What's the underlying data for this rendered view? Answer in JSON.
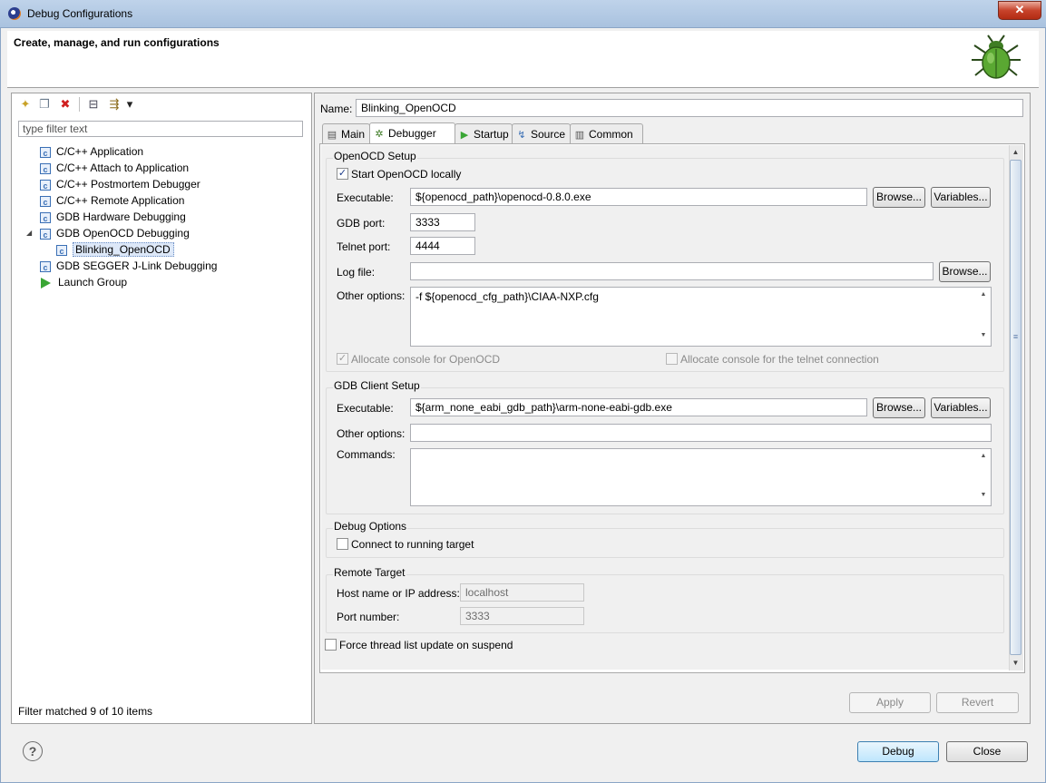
{
  "window": {
    "title": "Debug Configurations",
    "close_glyph": "✕",
    "banner_title": "Create, manage, and run configurations",
    "icon": "eclipse-icon"
  },
  "left": {
    "toolbar": [
      {
        "name": "new-configuration-icon",
        "glyph": "✦"
      },
      {
        "name": "duplicate-icon",
        "glyph": "❐"
      },
      {
        "name": "delete-icon",
        "glyph": "✖"
      },
      {
        "name": "collapse-all-icon",
        "glyph": "⊟"
      },
      {
        "name": "filter-icon",
        "glyph": "⇶"
      },
      {
        "name": "menu-dropdown-icon",
        "glyph": "▾"
      }
    ],
    "filter_placeholder": "type filter text",
    "tree": [
      {
        "label": "C/C++ Application",
        "icon": "c-icon"
      },
      {
        "label": "C/C++ Attach to Application",
        "icon": "c-icon"
      },
      {
        "label": "C/C++ Postmortem Debugger",
        "icon": "c-icon"
      },
      {
        "label": "C/C++ Remote Application",
        "icon": "c-icon"
      },
      {
        "label": "GDB Hardware Debugging",
        "icon": "c-icon"
      },
      {
        "label": "GDB OpenOCD Debugging",
        "icon": "c-icon",
        "expanded": true
      },
      {
        "label": "Blinking_OpenOCD",
        "icon": "c-icon",
        "selected": true
      },
      {
        "label": "GDB SEGGER J-Link Debugging",
        "icon": "c-icon"
      },
      {
        "label": "Launch Group",
        "icon": "play-icon"
      }
    ],
    "expand_glyph": "◢",
    "icon_letter": "c",
    "filter_status": "Filter matched 9 of 10 items"
  },
  "right": {
    "name_label": "Name:",
    "name_value": "Blinking_OpenOCD",
    "tabs": [
      {
        "label": "Main",
        "icon": "main-tab-icon",
        "glyph": "▤"
      },
      {
        "label": "Debugger",
        "icon": "bug-icon",
        "glyph": "✲",
        "active": true
      },
      {
        "label": "Startup",
        "icon": "startup-icon",
        "glyph": "▶"
      },
      {
        "label": "Source",
        "icon": "source-icon",
        "glyph": "↯"
      },
      {
        "label": "Common",
        "icon": "common-icon",
        "glyph": "▥"
      }
    ],
    "openocd": {
      "title": "OpenOCD Setup",
      "start_locally_label": "Start OpenOCD locally",
      "start_locally": true,
      "executable_label": "Executable:",
      "executable_value": "${openocd_path}\\openocd-0.8.0.exe",
      "browse_label": "Browse...",
      "variables_label": "Variables...",
      "gdb_port_label": "GDB port:",
      "gdb_port_value": "3333",
      "telnet_port_label": "Telnet port:",
      "telnet_port_value": "4444",
      "log_file_label": "Log file:",
      "log_file_value": "",
      "other_options_label": "Other options:",
      "other_options_value": "-f ${openocd_cfg_path}\\CIAA-NXP.cfg",
      "alloc_console_label": "Allocate console for OpenOCD",
      "alloc_telnet_label": "Allocate console for the telnet connection",
      "check_glyph": "✓"
    },
    "gdb_client": {
      "title": "GDB Client Setup",
      "executable_label": "Executable:",
      "executable_value": "${arm_none_eabi_gdb_path}\\arm-none-eabi-gdb.exe",
      "browse_label": "Browse...",
      "variables_label": "Variables...",
      "other_options_label": "Other options:",
      "other_options_value": "",
      "commands_label": "Commands:",
      "commands_value": ""
    },
    "debug_options": {
      "title": "Debug Options",
      "connect_label": "Connect to running target"
    },
    "remote_target": {
      "title": "Remote Target",
      "host_label": "Host name or IP address:",
      "host_value": "localhost",
      "port_label": "Port number:",
      "port_value": "3333"
    },
    "force_thread_label": "Force thread list update on suspend",
    "apply_label": "Apply",
    "revert_label": "Revert"
  },
  "footer": {
    "help_glyph": "?",
    "debug_label": "Debug",
    "close_label": "Close"
  }
}
